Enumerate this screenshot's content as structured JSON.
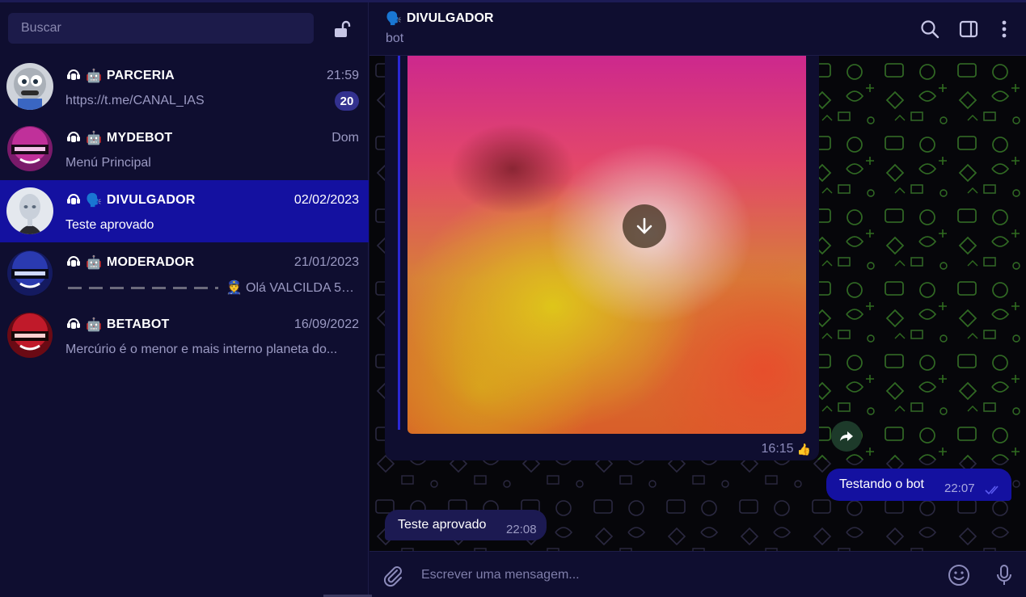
{
  "sidebar": {
    "search_placeholder": "Buscar",
    "chats": [
      {
        "name": "PARCERIA",
        "time": "21:59",
        "preview": "https://t.me/CANAL_IAS",
        "unread": "20",
        "type_icon": "robot-icon"
      },
      {
        "name": "MYDEBOT",
        "time": "Dom",
        "preview": "Menú Principal",
        "unread": "",
        "type_icon": "robot-icon"
      },
      {
        "name": "DIVULGADOR",
        "time": "02/02/2023",
        "preview": "Teste aprovado",
        "unread": "",
        "type_icon": "speaking-head-icon"
      },
      {
        "name": "MODERADOR",
        "time": "21/01/2023",
        "preview": "👮 Olá VALCILDA 51...",
        "unread": "",
        "type_icon": "robot-icon"
      },
      {
        "name": "BETABOT",
        "time": "16/09/2022",
        "preview": "Mercúrio é o menor e mais interno planeta do...",
        "unread": "",
        "type_icon": "robot-icon"
      }
    ]
  },
  "chat": {
    "title": "DIVULGADOR",
    "title_emoji": "🗣️",
    "subtitle": "bot",
    "media_time": "16:15",
    "media_reaction": "👍",
    "outgoing": {
      "text": "Testando o bot",
      "time": "22:07"
    },
    "incoming": {
      "text": "Teste aprovado",
      "time": "22:08"
    },
    "composer_placeholder": "Escrever uma mensagem..."
  },
  "colors": {
    "background": "#0f0e30",
    "accent": "#1411a0",
    "pattern": "#2f6b1f"
  }
}
